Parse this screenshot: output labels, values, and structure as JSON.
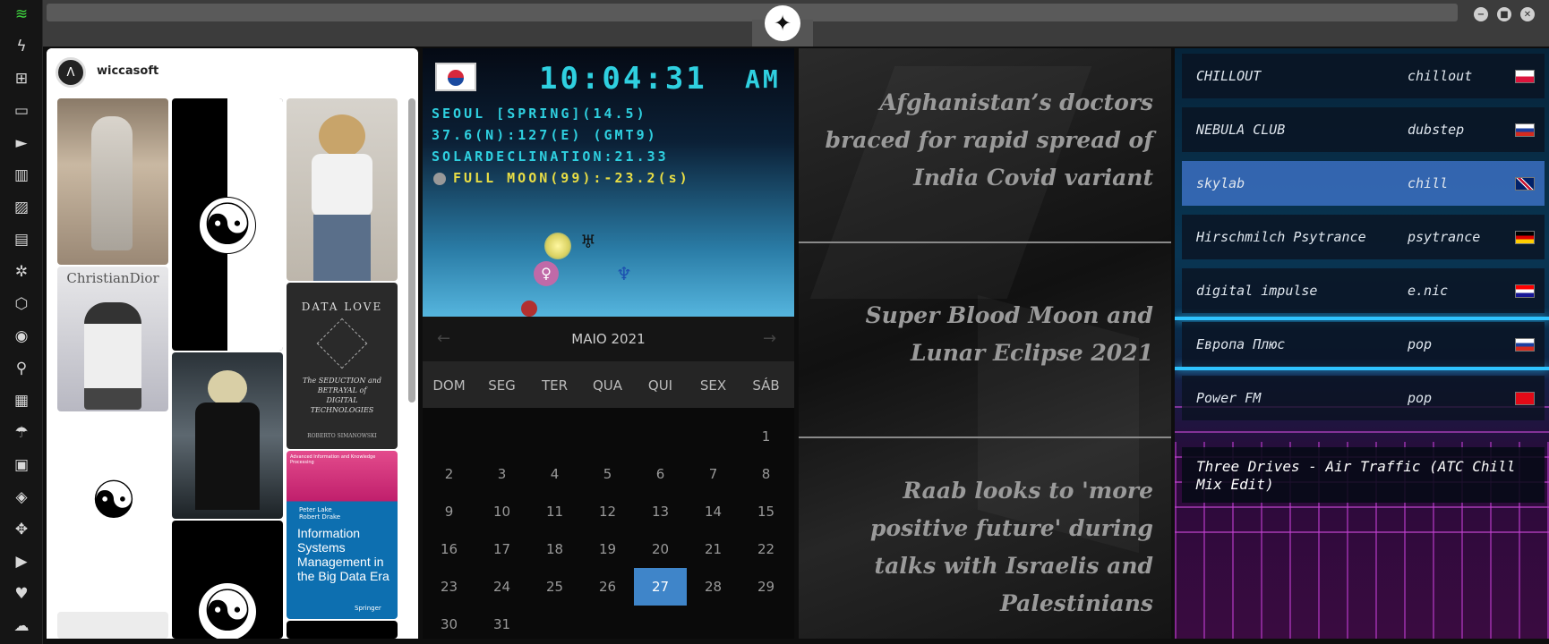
{
  "rail": {
    "icons": [
      "wifi-icon",
      "bolt-icon",
      "windows-icon",
      "archive-icon",
      "play-icon",
      "map-book-icon",
      "image-icon",
      "news-icon",
      "rebel-icon",
      "hexagon-icon",
      "globe-icon",
      "search-icon",
      "map-icon",
      "umbrella-icon",
      "contacts-icon",
      "code-icon",
      "expand-icon",
      "youtube-icon",
      "heart-icon",
      "cloud-icon"
    ],
    "glyphs": [
      "≋",
      "ϟ",
      "⊞",
      "▭",
      "►",
      "▥",
      "▨",
      "▤",
      "✲",
      "⬡",
      "◉",
      "⚲",
      "▦",
      "☂",
      "▣",
      "◈",
      "✥",
      "▶",
      "♥",
      "☁"
    ]
  },
  "topbar": {
    "logo_glyph": "✦",
    "controls": [
      "−",
      "■",
      "✕"
    ]
  },
  "pinterest": {
    "username": "wiccasoft",
    "avatar_glyph": "Λ",
    "pins": [
      {
        "label": "",
        "kind": "photo"
      },
      {
        "label": "",
        "kind": "yinyang"
      },
      {
        "label": "",
        "kind": "photo"
      },
      {
        "label": "ChristianDior",
        "kind": "photo"
      },
      {
        "label": "",
        "kind": "photo"
      },
      {
        "label": "",
        "kind": "yinyang"
      }
    ],
    "book1": {
      "title": "DATA LOVE",
      "subtitle": "The SEDUCTION and BETRAYAL of DIGITAL TECHNOLOGIES",
      "author": "ROBERTO SIMANOWSKI"
    },
    "book2": {
      "series": "Advanced Information and Knowledge Processing",
      "authors": "Peter Lake Robert Drake",
      "title": "Information Systems Management in the Big Data Era",
      "publisher": "Springer"
    }
  },
  "clock": {
    "time": "10:04:31",
    "ampm": "AM",
    "line1": "SEOUL [SPRING](14.5)",
    "line2": "37.6(N):127(E) (GMT9)",
    "line3": "SOLARDECLINATION:21.33",
    "line4": "FULL MOON(99):-23.2(s)"
  },
  "calendar": {
    "title": "MAIO 2021",
    "weekdays": [
      "DOM",
      "SEG",
      "TER",
      "QUA",
      "QUI",
      "SEX",
      "SÁB"
    ],
    "first_weekday": 6,
    "days_in_month": 31,
    "selected": 27,
    "prev": "←",
    "next": "→"
  },
  "news": {
    "headlines": [
      "Afghanistan’s doctors braced for rapid spread of India Covid variant",
      "Super Blood Moon and Lunar Eclipse 2021",
      "Raab looks to 'more positive future' during talks with Israelis and Palestinians"
    ]
  },
  "radio": {
    "stations": [
      {
        "name": "CHILLOUT",
        "genre": "chillout",
        "flag": "pl"
      },
      {
        "name": "NEBULA CLUB",
        "genre": "dubstep",
        "flag": "ru"
      },
      {
        "name": "skylab",
        "genre": "chill",
        "flag": "gb"
      },
      {
        "name": "Hirschmilch Psytrance",
        "genre": "psytrance",
        "flag": "de"
      },
      {
        "name": "digital impulse",
        "genre": "e.nic",
        "flag": "hr"
      },
      {
        "name": "Европа Плюс",
        "genre": "pop",
        "flag": "ru"
      },
      {
        "name": "Power FM",
        "genre": "pop",
        "flag": "tr"
      }
    ],
    "active_index": 2,
    "now_playing": "Three Drives - Air Traffic (ATC Chill Mix Edit)"
  },
  "colors": {
    "accent": "#3f85c9",
    "lcd": "#2fd0e0",
    "lcd_yellow": "#e8dd45"
  }
}
